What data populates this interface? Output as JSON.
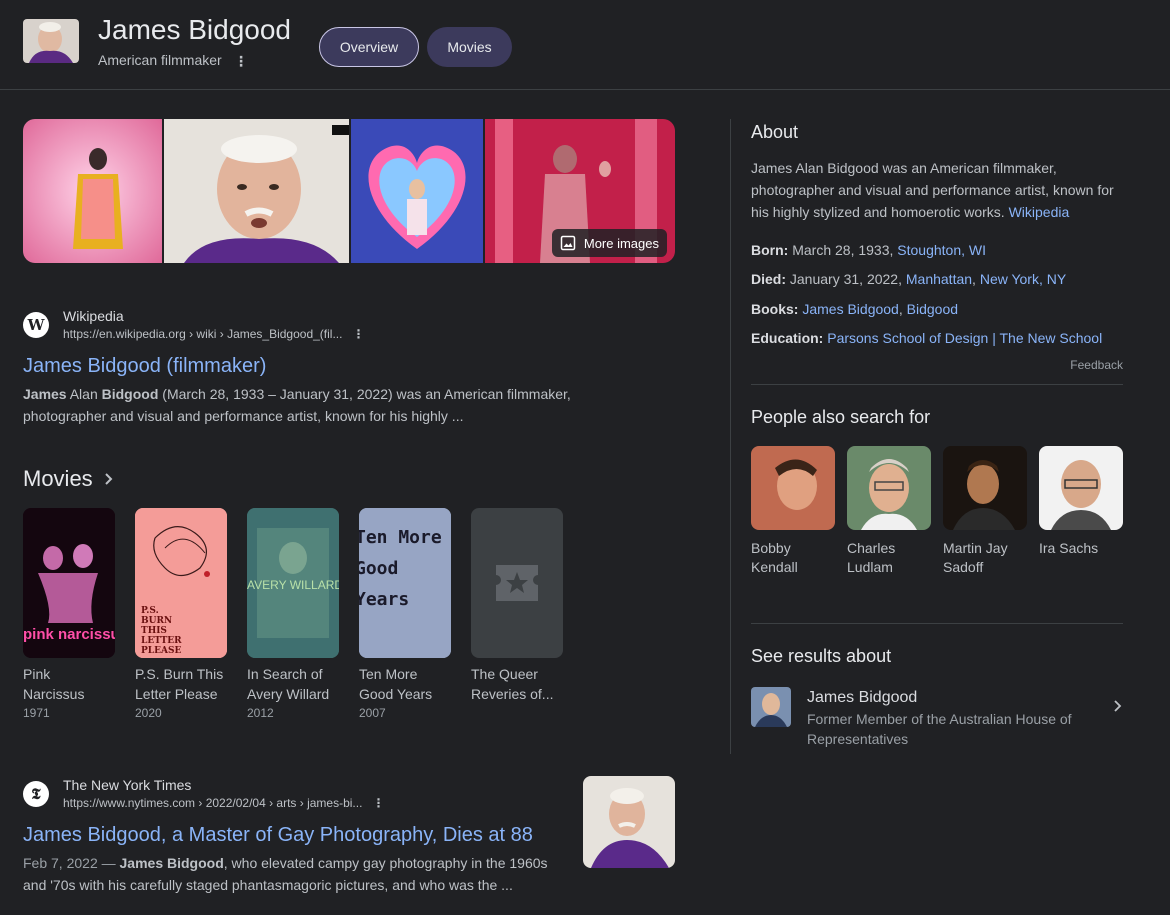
{
  "header": {
    "title": "James Bidgood",
    "subtitle": "American filmmaker",
    "tabs": [
      {
        "label": "Overview"
      },
      {
        "label": "Movies"
      }
    ]
  },
  "images": {
    "more_label": "More images"
  },
  "results": [
    {
      "site_name": "Wikipedia",
      "favicon_letter": "W",
      "url": "https://en.wikipedia.org › wiki › James_Bidgood_(fil...",
      "title": "James Bidgood (filmmaker)",
      "snippet_parts": [
        "James",
        " Alan ",
        "Bidgood",
        " (March 28, 1933 – January 31, 2022) was an American filmmaker, photographer and visual and performance artist, known for his highly ..."
      ]
    },
    {
      "site_name": "The New York Times",
      "favicon_letter": "𝕿",
      "url": "https://www.nytimes.com › 2022/02/04 › arts › james-bi...",
      "title": "James Bidgood, a Master of Gay Photography, Dies at 88",
      "date": "Feb 7, 2022",
      "snippet_bold": "James Bidgood",
      "snippet_rest": ", who elevated campy gay photography in the 1960s and '70s with his carefully staged phantasmagoric pictures, and who was the ..."
    }
  ],
  "movies": {
    "heading": "Movies",
    "items": [
      {
        "title": "Pink Narcissus",
        "year": "1971",
        "poster_text": "pink narcissus"
      },
      {
        "title": "P.S. Burn This Letter Please",
        "year": "2020",
        "poster_text": "P.S. BURN THIS LETTER PLEASE"
      },
      {
        "title": "In Search of Avery Willard",
        "year": "2012",
        "poster_text": "AVERY WILLARD"
      },
      {
        "title": "Ten More Good Years",
        "year": "2007",
        "poster_text": "Ten More Good Years"
      },
      {
        "title": "The Queer Reveries of...",
        "year": "",
        "poster_text": ""
      }
    ]
  },
  "panel": {
    "about_heading": "About",
    "about_text": "James Alan Bidgood was an American filmmaker, photographer and visual and performance artist, known for his highly stylized and homoerotic works.",
    "about_source": "Wikipedia",
    "facts": [
      {
        "label": "Born:",
        "text": " March 28, 1933, ",
        "links": [
          "Stoughton, WI"
        ]
      },
      {
        "label": "Died:",
        "text": " January 31, 2022, ",
        "links": [
          "Manhattan",
          "New York, NY"
        ]
      },
      {
        "label": "Books:",
        "text": " ",
        "links": [
          "James Bidgood",
          "Bidgood"
        ]
      },
      {
        "label": "Education:",
        "text": " ",
        "links": [
          "Parsons School of Design | The New School"
        ]
      }
    ],
    "feedback": "Feedback",
    "people_heading": "People also search for",
    "people": [
      {
        "name": "Bobby Kendall"
      },
      {
        "name": "Charles Ludlam"
      },
      {
        "name": "Martin Jay Sadoff"
      },
      {
        "name": "Ira Sachs"
      }
    ],
    "see_heading": "See results about",
    "see_item": {
      "name": "James Bidgood",
      "desc": "Former Member of the Australian House of Representatives"
    }
  },
  "colors": {
    "background": "#202124",
    "link": "#8ab4f8",
    "pill": "#3c3a5c"
  }
}
